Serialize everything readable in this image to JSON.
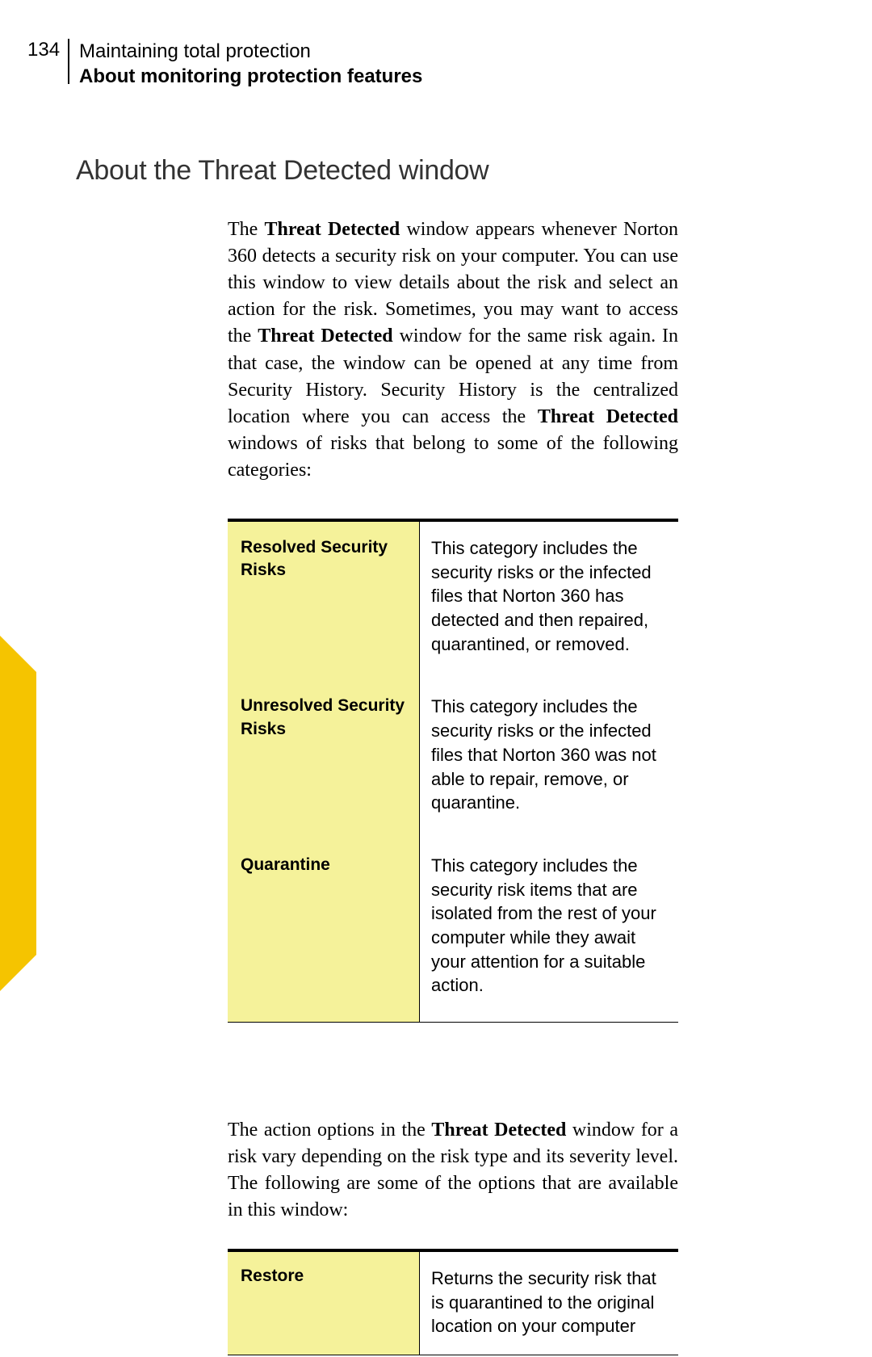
{
  "header": {
    "page_number": "134",
    "line1": "Maintaining total protection",
    "line2": "About monitoring protection features"
  },
  "section_heading": "About the Threat Detected window",
  "paragraph1": {
    "part1": "The ",
    "bold1": "Threat Detected",
    "part2": " window appears whenever Norton 360 detects a security risk on your computer. You can use this window to view details about the risk and select an action for the risk. Sometimes, you may want to access the ",
    "bold2": "Threat Detected",
    "part3": " window for the same risk again. In that case, the window can be opened at any time from Security History. Security History is the centralized location where you can access the ",
    "bold3": "Threat Detected",
    "part4": " windows of risks that belong to some of the following categories:"
  },
  "categories": [
    {
      "label": "Resolved Security Risks",
      "desc": "This category includes the security risks or the infected files that Norton 360 has detected and then repaired, quarantined, or removed."
    },
    {
      "label": "Unresolved Security Risks",
      "desc": "This category includes the security risks or the infected files that Norton 360 was not able to repair, remove, or quarantine."
    },
    {
      "label": "Quarantine",
      "desc": "This category includes the security risk items that are isolated from the rest of your computer while they await your attention for a suitable action."
    }
  ],
  "paragraph2": {
    "part1": "The action options in the ",
    "bold1": "Threat Detected",
    "part2": " window for a risk vary depending on the risk type and its severity level. The following are some of the options that are available in this window:"
  },
  "options": [
    {
      "label": "Restore",
      "desc": "Returns the security risk that is quarantined to the original location on your computer"
    }
  ]
}
